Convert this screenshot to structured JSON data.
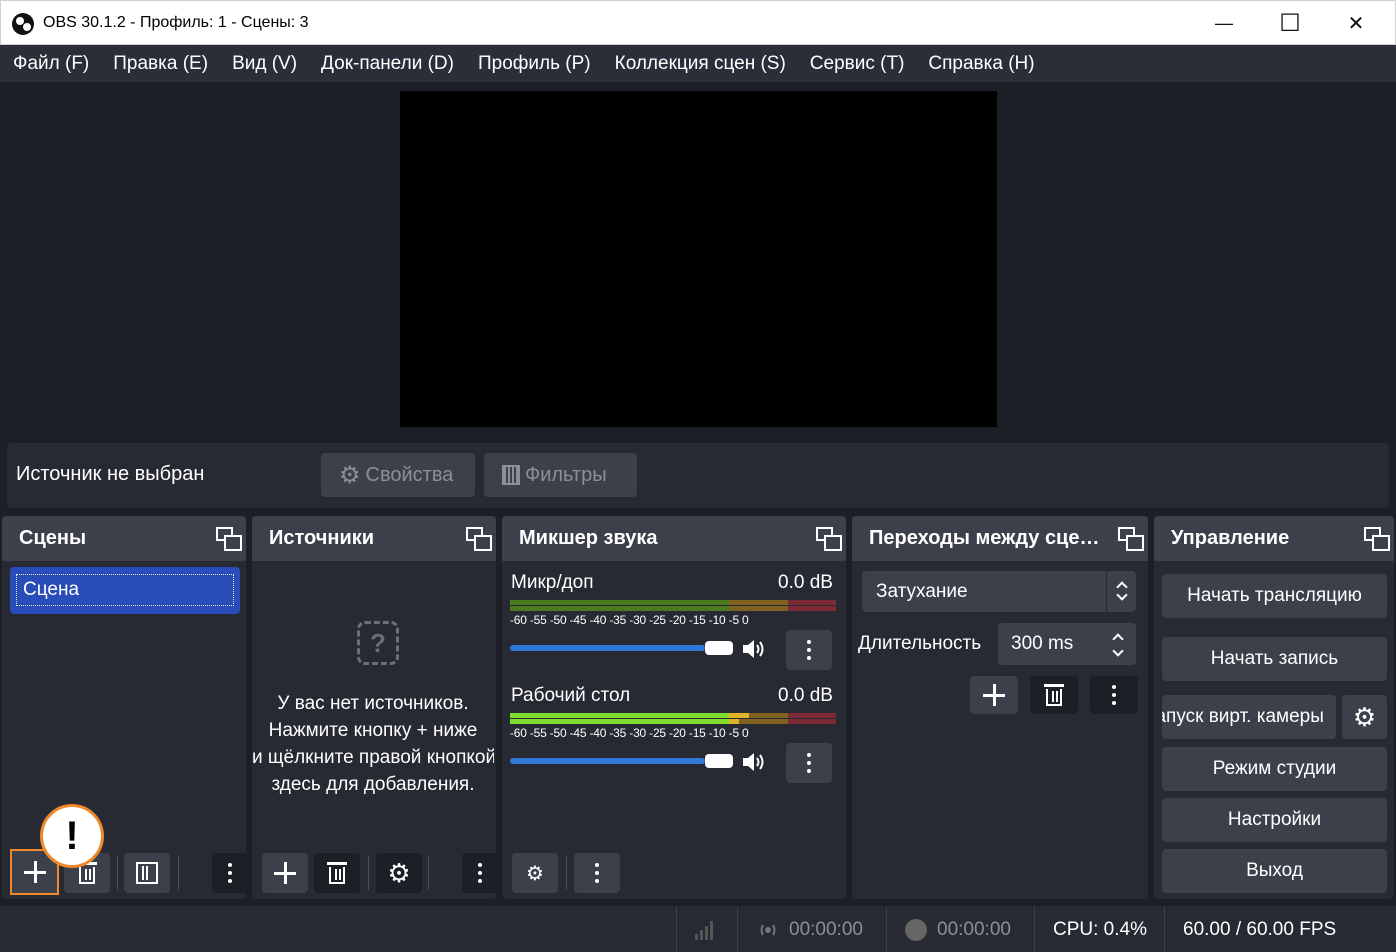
{
  "window": {
    "title": "OBS 30.1.2 - Профиль: 1 - Сцены: 3",
    "minimize": "—",
    "maximize": "☐",
    "close": "✕"
  },
  "menu": [
    "Файл (F)",
    "Правка (E)",
    "Вид (V)",
    "Док-панели (D)",
    "Профиль (P)",
    "Коллекция сцен (S)",
    "Сервис (T)",
    "Справка (H)"
  ],
  "context_bar": {
    "no_source": "Источник не выбран",
    "properties": "Свойства",
    "filters": "Фильтры"
  },
  "scenes": {
    "title": "Сцены",
    "items": [
      "Сцена"
    ]
  },
  "sources": {
    "title": "Источники",
    "empty_lines": [
      "У вас нет источников.",
      "Нажмите кнопку + ниже",
      "и щёлкните правой кнопкой",
      "здесь для добавления."
    ]
  },
  "mixer": {
    "title": "Микшер звука",
    "channels": [
      {
        "name": "Микр/доп",
        "db": "0.0 dB",
        "level": 0.0,
        "volume": 1.0
      },
      {
        "name": "Рабочий стол",
        "db": "0.0 dB",
        "level": 0.5,
        "volume": 1.0
      }
    ],
    "scale": "-60 -55 -50 -45 -40 -35 -30 -25 -20 -15 -10  -5   0"
  },
  "transitions": {
    "title": "Переходы между сценами",
    "selected": "Затухание",
    "duration_label": "Длительность",
    "duration_value": "300 ms"
  },
  "controls": {
    "title": "Управление",
    "start_stream": "Начать трансляцию",
    "start_record": "Начать запись",
    "virtual_cam": "Запуск вирт. камеры",
    "studio_mode": "Режим студии",
    "settings": "Настройки",
    "exit": "Выход"
  },
  "status": {
    "stream_time": "00:00:00",
    "record_time": "00:00:00",
    "cpu": "CPU: 0.4%",
    "fps": "60.00 / 60.00 FPS"
  },
  "colors": {
    "accent": "#284cb8",
    "warning": "#f0882c",
    "panel": "#272a33",
    "button": "#3c404b",
    "background": "#1d1f26"
  },
  "overlay": {
    "alert": "!"
  }
}
